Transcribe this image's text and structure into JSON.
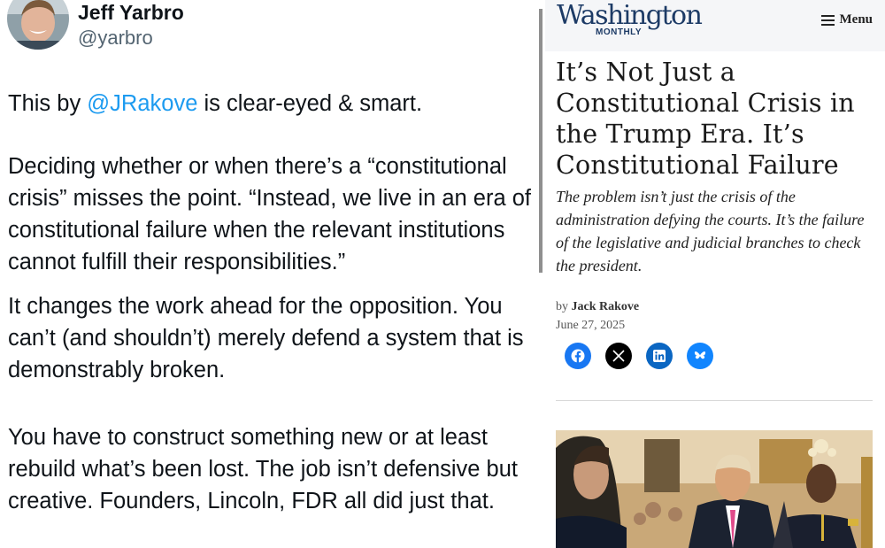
{
  "tweet": {
    "author_name": "Jeff Yarbro",
    "author_handle": "@yarbro",
    "p1_before": "This by ",
    "p1_mention": "@JRakove",
    "p1_after": " is clear-eyed & smart.",
    "p2": "Deciding whether or when there’s a “constitutional crisis” misses the point. “Instead, we live in an era of constitutional failure when the relevant institutions cannot fulfill their responsibilities.”",
    "p3": "It changes the work ahead for the opposition.  You can’t (and shouldn’t) merely defend a system that is demonstrably broken.",
    "p4": "You have to construct something new or at least rebuild what’s been lost. The job isn’t defensive but creative. Founders, Lincoln, FDR all did just that."
  },
  "article": {
    "site_logo_main": "Washington",
    "site_logo_sub": "MONTHLY",
    "menu_label": "Menu",
    "headline": "It’s Not Just a Constitutional Crisis in the Trump Era. It’s Constitutional Failure",
    "dek": "The problem isn’t just the crisis of the administration defying the courts. It’s the failure of the legislative and judicial branches to check the president.",
    "byline_prefix": "by",
    "author": "Jack Rakove",
    "date": "June 27, 2025",
    "share": [
      {
        "name": "facebook-icon",
        "color": "#1877f2"
      },
      {
        "name": "x-icon",
        "color": "#000000"
      },
      {
        "name": "linkedin-icon",
        "color": "#0a66c2"
      },
      {
        "name": "bluesky-icon",
        "color": "#1185fe"
      }
    ]
  }
}
